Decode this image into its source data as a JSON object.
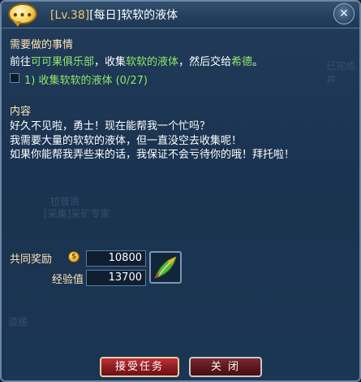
{
  "window": {
    "title_level": "[Lv.38]",
    "title_name": "[每日]软软的液体",
    "close_glyph": "✕"
  },
  "todo": {
    "heading": "需要做的事情",
    "instruction_prefix": "前往",
    "instruction_place": "可可果俱乐部",
    "instruction_middle": "，收集",
    "instruction_item": "软软的液体",
    "instruction_suffix": "，然后交给",
    "instruction_npc": "希德",
    "instruction_end": "。",
    "objective": "1) 收集软软的液体 (0/27)"
  },
  "content": {
    "heading": "内容",
    "lines": [
      "好久不见啦，勇士！现在能帮我一个忙吗？",
      "我需要大量的软软的液体，但一直没空去收集呢！",
      "如果你能帮我弄些来的话，我保证不会亏待你的哦！拜托啦！"
    ]
  },
  "background_text": {
    "right_label": "已完成并",
    "npc_name": "[采集]采矿专家",
    "npc_partial": "拉普浪",
    "bottom_left": "道居"
  },
  "rewards": {
    "heading": "共同奖励",
    "gold_value": "10800",
    "exp_label": "经验值",
    "exp_value": "13700",
    "item_icon": "green-feather-icon"
  },
  "buttons": {
    "accept": "接受任务",
    "close": "关 闭"
  },
  "colors": {
    "accent_gold": "#f2c96a",
    "highlight_green": "#8fe86a",
    "heading": "#ffe4b6",
    "button_red": "#8d1a22"
  }
}
